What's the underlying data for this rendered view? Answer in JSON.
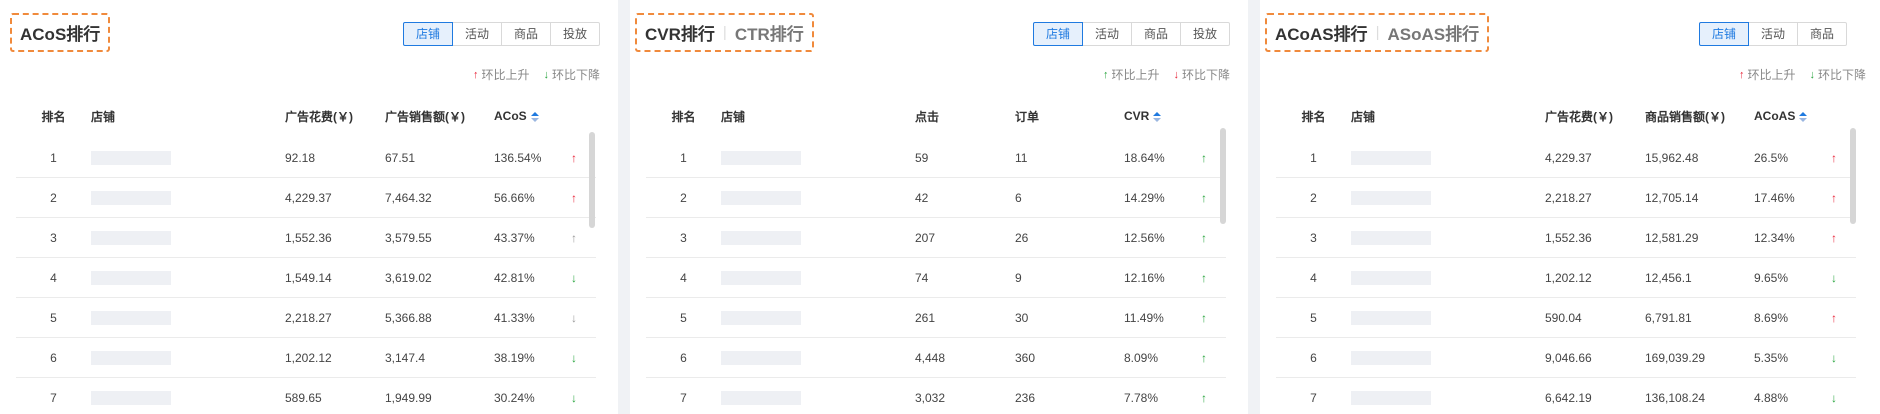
{
  "colors": {
    "accent": "#1f7ae0",
    "title_border": "#f08a3c",
    "up_red": "#e8263a",
    "green": "#2aa53f",
    "gray": "#999999"
  },
  "panels": [
    {
      "title": "ACoS排行",
      "title_alt": "",
      "segments": [
        "店铺",
        "活动",
        "商品",
        "投放"
      ],
      "active_segment": 0,
      "legend": [
        {
          "arrow": "↑",
          "icon": "arrow-up-red-icon",
          "label": "环比上升"
        },
        {
          "arrow": "↓",
          "icon": "arrow-down-green-icon",
          "label": "环比下降"
        }
      ],
      "columns": [
        "排名",
        "店铺",
        "广告花费(￥)",
        "广告销售额(￥)",
        "ACoS"
      ],
      "rows": [
        {
          "rank": "1",
          "a": "92.18",
          "b": "67.51",
          "c": "136.54%",
          "trend": "↑",
          "trend_class": "up-red"
        },
        {
          "rank": "2",
          "a": "4,229.37",
          "b": "7,464.32",
          "c": "56.66%",
          "trend": "↑",
          "trend_class": "up-red"
        },
        {
          "rank": "3",
          "a": "1,552.36",
          "b": "3,579.55",
          "c": "43.37%",
          "trend": "↑",
          "trend_class": "up-gray"
        },
        {
          "rank": "4",
          "a": "1,549.14",
          "b": "3,619.02",
          "c": "42.81%",
          "trend": "↓",
          "trend_class": "down-green"
        },
        {
          "rank": "5",
          "a": "2,218.27",
          "b": "5,366.88",
          "c": "41.33%",
          "trend": "↓",
          "trend_class": "down-gray"
        },
        {
          "rank": "6",
          "a": "1,202.12",
          "b": "3,147.4",
          "c": "38.19%",
          "trend": "↓",
          "trend_class": "down-green"
        },
        {
          "rank": "7",
          "a": "589.65",
          "b": "1,949.99",
          "c": "30.24%",
          "trend": "↓",
          "trend_class": "down-green"
        }
      ]
    },
    {
      "title": "CVR排行",
      "title_alt": "CTR排行",
      "segments": [
        "店铺",
        "活动",
        "商品",
        "投放"
      ],
      "active_segment": 0,
      "legend": [
        {
          "arrow": "↑",
          "icon": "arrow-up-green-icon",
          "label": "环比上升"
        },
        {
          "arrow": "↓",
          "icon": "arrow-down-red-icon",
          "label": "环比下降"
        }
      ],
      "columns": [
        "排名",
        "店铺",
        "点击",
        "订单",
        "CVR"
      ],
      "rows": [
        {
          "rank": "1",
          "a": "59",
          "b": "11",
          "c": "18.64%",
          "trend": "↑",
          "trend_class": "up-green"
        },
        {
          "rank": "2",
          "a": "42",
          "b": "6",
          "c": "14.29%",
          "trend": "↑",
          "trend_class": "up-green"
        },
        {
          "rank": "3",
          "a": "207",
          "b": "26",
          "c": "12.56%",
          "trend": "↑",
          "trend_class": "up-green"
        },
        {
          "rank": "4",
          "a": "74",
          "b": "9",
          "c": "12.16%",
          "trend": "↑",
          "trend_class": "up-green"
        },
        {
          "rank": "5",
          "a": "261",
          "b": "30",
          "c": "11.49%",
          "trend": "↑",
          "trend_class": "up-green"
        },
        {
          "rank": "6",
          "a": "4,448",
          "b": "360",
          "c": "8.09%",
          "trend": "↑",
          "trend_class": "up-green"
        },
        {
          "rank": "7",
          "a": "3,032",
          "b": "236",
          "c": "7.78%",
          "trend": "↑",
          "trend_class": "up-green"
        }
      ]
    },
    {
      "title": "ACoAS排行",
      "title_alt": "ASoAS排行",
      "segments": [
        "店铺",
        "活动",
        "商品"
      ],
      "active_segment": 0,
      "legend": [
        {
          "arrow": "↑",
          "icon": "arrow-up-red-icon",
          "label": "环比上升"
        },
        {
          "arrow": "↓",
          "icon": "arrow-down-green-icon",
          "label": "环比下降"
        }
      ],
      "columns": [
        "排名",
        "店铺",
        "广告花费(￥)",
        "商品销售额(￥)",
        "ACoAS"
      ],
      "rows": [
        {
          "rank": "1",
          "a": "4,229.37",
          "b": "15,962.48",
          "c": "26.5%",
          "trend": "↑",
          "trend_class": "up-red"
        },
        {
          "rank": "2",
          "a": "2,218.27",
          "b": "12,705.14",
          "c": "17.46%",
          "trend": "↑",
          "trend_class": "up-red"
        },
        {
          "rank": "3",
          "a": "1,552.36",
          "b": "12,581.29",
          "c": "12.34%",
          "trend": "↑",
          "trend_class": "up-red"
        },
        {
          "rank": "4",
          "a": "1,202.12",
          "b": "12,456.1",
          "c": "9.65%",
          "trend": "↓",
          "trend_class": "down-green"
        },
        {
          "rank": "5",
          "a": "590.04",
          "b": "6,791.81",
          "c": "8.69%",
          "trend": "↑",
          "trend_class": "up-red"
        },
        {
          "rank": "6",
          "a": "9,046.66",
          "b": "169,039.29",
          "c": "5.35%",
          "trend": "↓",
          "trend_class": "down-green"
        },
        {
          "rank": "7",
          "a": "6,642.19",
          "b": "136,108.24",
          "c": "4.88%",
          "trend": "↓",
          "trend_class": "down-green"
        }
      ]
    }
  ]
}
